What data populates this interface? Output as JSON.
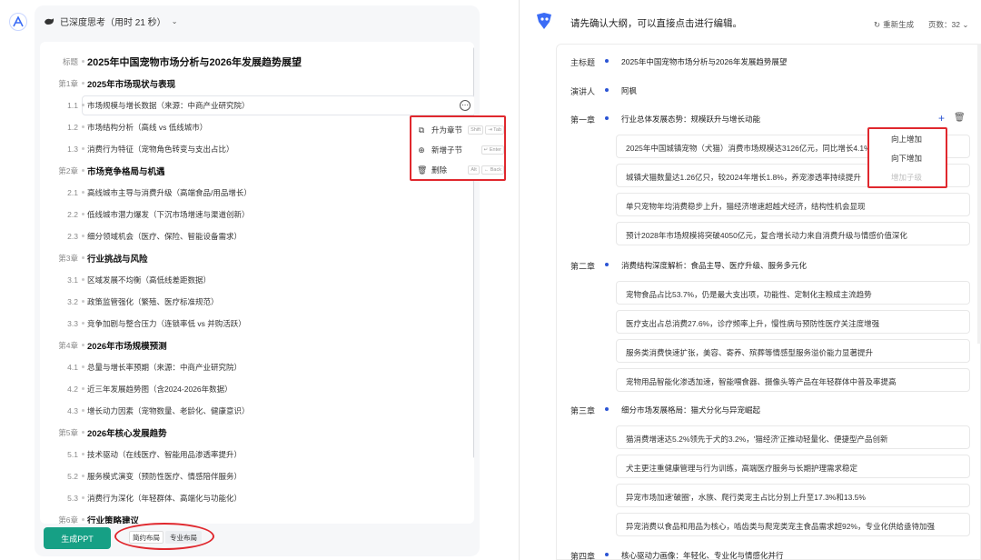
{
  "left": {
    "think_label": "已深度思考（用时 21 秒）",
    "outline": [
      {
        "label": "标题",
        "text": "2025年中国宠物市场分析与2026年发展趋势展望",
        "kind": "title"
      },
      {
        "label": "第1章",
        "text": "2025年市场现状与表现",
        "kind": "chapter"
      },
      {
        "label": "1.1",
        "text": "市场规模与增长数据（来源：中商产业研究院）",
        "kind": "item"
      },
      {
        "label": "1.2",
        "text": "市场结构分析（高线 vs 低线城市）",
        "kind": "item"
      },
      {
        "label": "1.3",
        "text": "消费行为特征（宠物角色转变与支出占比）",
        "kind": "item"
      },
      {
        "label": "第2章",
        "text": "市场竞争格局与机遇",
        "kind": "chapter"
      },
      {
        "label": "2.1",
        "text": "高线城市主导与消费升级（高端食品/用品增长）",
        "kind": "item"
      },
      {
        "label": "2.2",
        "text": "低线城市潜力爆发（下沉市场增速与渠道创新）",
        "kind": "item"
      },
      {
        "label": "2.3",
        "text": "细分领域机会（医疗、保险、智能设备需求）",
        "kind": "item"
      },
      {
        "label": "第3章",
        "text": "行业挑战与风险",
        "kind": "chapter"
      },
      {
        "label": "3.1",
        "text": "区域发展不均衡（高低线差距数据）",
        "kind": "item"
      },
      {
        "label": "3.2",
        "text": "政策监管强化（繁殖、医疗标准规范）",
        "kind": "item"
      },
      {
        "label": "3.3",
        "text": "竞争加剧与整合压力（连锁率低 vs 并购活跃）",
        "kind": "item"
      },
      {
        "label": "第4章",
        "text": "2026年市场规模预测",
        "kind": "chapter"
      },
      {
        "label": "4.1",
        "text": "总量与增长率预期（来源：中商产业研究院）",
        "kind": "item"
      },
      {
        "label": "4.2",
        "text": "近三年发展趋势图（含2024-2026年数据）",
        "kind": "item"
      },
      {
        "label": "4.3",
        "text": "增长动力因素（宠物数量、老龄化、健康意识）",
        "kind": "item"
      },
      {
        "label": "第5章",
        "text": "2026年核心发展趋势",
        "kind": "chapter"
      },
      {
        "label": "5.1",
        "text": "技术驱动（在线医疗、智能用品渗透率提升）",
        "kind": "item"
      },
      {
        "label": "5.2",
        "text": "服务模式演变（预防性医疗、情感陪伴服务）",
        "kind": "item"
      },
      {
        "label": "5.3",
        "text": "消费行为深化（年轻群体、高端化与功能化）",
        "kind": "item"
      },
      {
        "label": "第6章",
        "text": "行业策略建议",
        "kind": "chapter"
      }
    ],
    "context_menu": [
      {
        "icon": "⧉",
        "label": "升为章节",
        "keys": [
          "Shift",
          "⇥ Tab"
        ]
      },
      {
        "icon": "⊕",
        "label": "新增子节",
        "keys": [
          "↵ Enter"
        ]
      },
      {
        "icon": "🗑",
        "label": "删除",
        "keys": [
          "Alt",
          "← Back"
        ]
      }
    ],
    "generate_label": "生成PPT",
    "layout_options": [
      "简约布局",
      "专业布局"
    ]
  },
  "right": {
    "header": "请先确认大纲，可以直接点击进行编辑。",
    "regenerate_label": "重新生成",
    "pages_label": "页数：32",
    "title_label": "主标题",
    "title_value": "2025年中国宠物市场分析与2026年发展趋势展望",
    "speaker_label": "演讲人",
    "speaker_value": "阿枫",
    "chapters": [
      {
        "label": "第一章",
        "title": "行业总体发展态势：规模跃升与增长动能",
        "points": [
          "2025年中国城镇宠物（犬猫）消费市场规模达3126亿元，同比增长4.1%",
          "城镇犬猫数量达1.26亿只，较2024年增长1.8%，养宠渗透率持续提升",
          "单只宠物年均消费稳步上升，猫经济增速超越犬经济，结构性机会显现",
          "预计2028年市场规模将突破4050亿元，复合增长动力来自消费升级与情感价值深化"
        ]
      },
      {
        "label": "第二章",
        "title": "消费结构深度解析：食品主导、医疗升级、服务多元化",
        "points": [
          "宠物食品占比53.7%，仍是最大支出项，功能性、定制化主粮成主流趋势",
          "医疗支出占总消费27.6%，诊疗频率上升，慢性病与预防性医疗关注度增强",
          "服务类消费快速扩张，美容、寄养、殡葬等情感型服务溢价能力显著提升",
          "宠物用品智能化渗透加速，智能喂食器、摄像头等产品在年轻群体中普及率提高"
        ]
      },
      {
        "label": "第三章",
        "title": "细分市场发展格局：猫犬分化与异宠崛起",
        "points": [
          "猫消费增速达5.2%领先于犬的3.2%，'猫经济'正推动轻量化、便捷型产品创新",
          "犬主更注重健康管理与行为训练，高端医疗服务与长期护理需求稳定",
          "异宠市场加速'破圈'，水族、爬行类宠主占比分别上升至17.3%和13.5%",
          "异宠消费以食品和用品为核心，啮齿类与爬宠类宠主食品需求超92%，专业化供给亟待加强"
        ]
      },
      {
        "label": "第四章",
        "title": "核心驱动力画像：年轻化、专业化与情感化并行",
        "points": []
      }
    ],
    "add_menu": [
      {
        "label": "向上增加",
        "disabled": false
      },
      {
        "label": "向下增加",
        "disabled": false
      },
      {
        "label": "增加子级",
        "disabled": true
      }
    ]
  }
}
